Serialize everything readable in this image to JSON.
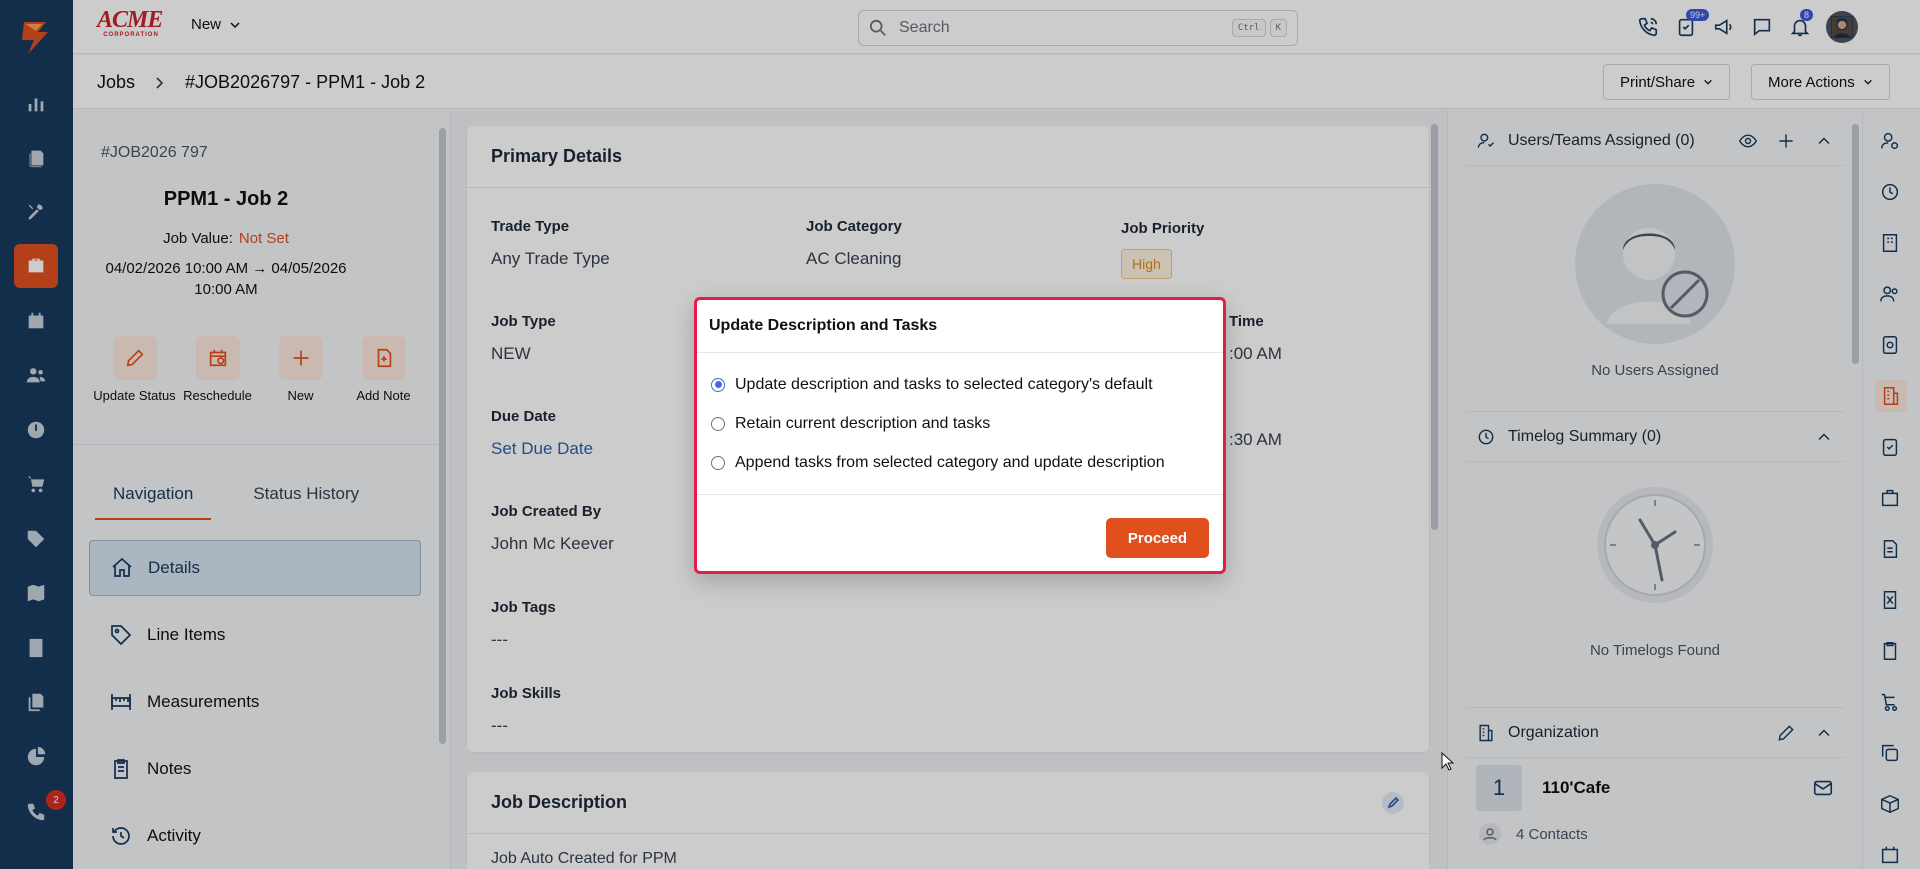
{
  "topbar": {
    "brand_top": "ACME",
    "brand_bottom": "CORPORATION",
    "new_label": "New",
    "search_placeholder": "Search",
    "kbd_ctrl": "Ctrl",
    "kbd_k": "K",
    "task_badge": "99+",
    "notif_badge": "8"
  },
  "rail": {
    "badge": "2"
  },
  "breadcrumb": {
    "root": "Jobs",
    "current": "#JOB2026797 - PPM1 - Job 2",
    "print_label": "Print/Share",
    "more_label": "More Actions"
  },
  "job": {
    "number": "#JOB2026 797",
    "title": "PPM1 - Job 2",
    "value_label": "Job Value:",
    "value": "Not Set",
    "dates": "04/02/2026 10:00 AM → 04/05/2026 10:00 AM"
  },
  "actions": [
    {
      "label": "Update Status"
    },
    {
      "label": "Reschedule"
    },
    {
      "label": "New"
    },
    {
      "label": "Add Note"
    }
  ],
  "tabs": {
    "navigation": "Navigation",
    "status_history": "Status History"
  },
  "nav": [
    {
      "label": "Details"
    },
    {
      "label": "Line Items"
    },
    {
      "label": "Measurements"
    },
    {
      "label": "Notes"
    },
    {
      "label": "Activity"
    }
  ],
  "primary": {
    "title": "Primary Details",
    "trade_type_label": "Trade Type",
    "trade_type": "Any Trade Type",
    "category_label": "Job Category",
    "category": "AC Cleaning",
    "priority_label": "Job Priority",
    "priority": "High",
    "job_type_label": "Job Type",
    "job_type": "NEW",
    "time_partial_label": "Time",
    "time_partial_1": ":00 AM",
    "time_partial_2": ":30 AM",
    "due_label": "Due Date",
    "due": "Set Due Date",
    "created_by_label": "Job Created By",
    "created_by": "John Mc Keever",
    "tags_label": "Job Tags",
    "tags": "---",
    "skills_label": "Job Skills",
    "skills": "---"
  },
  "description": {
    "title": "Job Description",
    "partial": "Job Auto Created for PPM"
  },
  "right": {
    "users_title": "Users/Teams Assigned (0)",
    "users_empty": "No Users Assigned",
    "timelog_title": "Timelog Summary (0)",
    "timelog_empty": "No Timelogs Found",
    "org_title": "Organization",
    "org_num": "1",
    "org_name": "110'Cafe",
    "contacts": "4 Contacts"
  },
  "modal": {
    "title": "Update Description and Tasks",
    "options": [
      {
        "label": "Update description and tasks to selected category's default",
        "selected": true
      },
      {
        "label": "Retain current description and tasks",
        "selected": false
      },
      {
        "label": "Append tasks from selected category and update description",
        "selected": false
      }
    ],
    "proceed": "Proceed"
  },
  "colors": {
    "accent": "#e0501f",
    "nav": "#173a5e",
    "modal_border": "#e11d48"
  }
}
